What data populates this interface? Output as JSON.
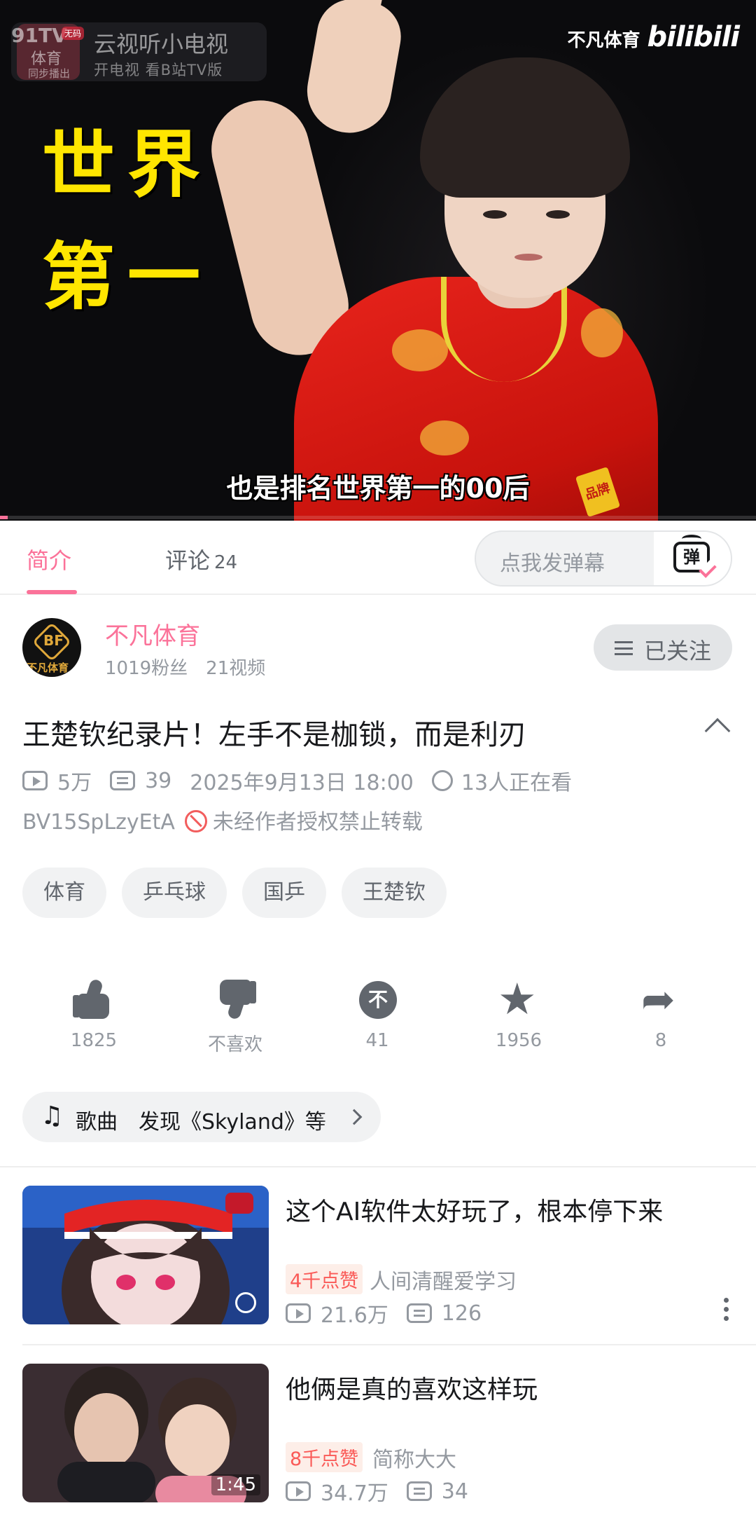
{
  "video": {
    "overlay_title_line1": "世界",
    "overlay_title_line2": "第一",
    "subtitle": "也是排名世界第一的00后",
    "watermark_left_logo": "91TV",
    "watermark_left_logo_sub": "体育",
    "watermark_left_logo_tag": "同步播出",
    "watermark_left_badge": "无码",
    "watermark_app_name": "云视听小电视",
    "watermark_app_sub": "开电视 看B站TV版",
    "watermark_channel": "不凡体育",
    "watermark_brand": "bilibili",
    "shirt_logo": "品牌",
    "progress_fraction": 0.01
  },
  "tabs": [
    {
      "label": "简介",
      "active": true
    },
    {
      "label": "评论",
      "count": "24",
      "active": false
    }
  ],
  "danmaku": {
    "placeholder": "点我发弹幕",
    "button_glyph": "弹"
  },
  "uploader": {
    "name": "不凡体育",
    "avatar_letter": "BF",
    "avatar_text": "不凡体育",
    "fans": "1019粉丝",
    "videos": "21视频",
    "follow_label": "已关注"
  },
  "details": {
    "title": "王楚钦纪录片！左手不是枷锁，而是利刃",
    "plays": "5万",
    "danmaku_count": "39",
    "publish_time": "2025年9月13日 18:00",
    "watching": "13人正在看",
    "bvid": "BV15SpLzyEtA",
    "copyright": "未经作者授权禁止转载"
  },
  "tags": [
    "体育",
    "乒乓球",
    "国乒",
    "王楚钦"
  ],
  "actions": {
    "like": "1825",
    "dislike": "不喜欢",
    "coin_glyph": "不",
    "coin": "41",
    "favorite": "1956",
    "share": "8"
  },
  "music": {
    "note_glyph": "♫",
    "label": "歌曲",
    "text": "发现《Skyland》等"
  },
  "recommendations": [
    {
      "title": "这个AI软件太好玩了，根本停下来",
      "badge": "4千点赞",
      "author": "人间清醒爱学习",
      "plays": "21.6万",
      "danmaku": "126",
      "duration": ""
    },
    {
      "title": "他俩是真的喜欢这样玩",
      "badge": "8千点赞",
      "author": "简称大大",
      "plays": "34.7万",
      "danmaku": "34",
      "duration": "1:45"
    }
  ],
  "colors": {
    "accent": "#fb7299",
    "title_yellow": "#ffe600",
    "shirt_red": "#e8241c"
  }
}
